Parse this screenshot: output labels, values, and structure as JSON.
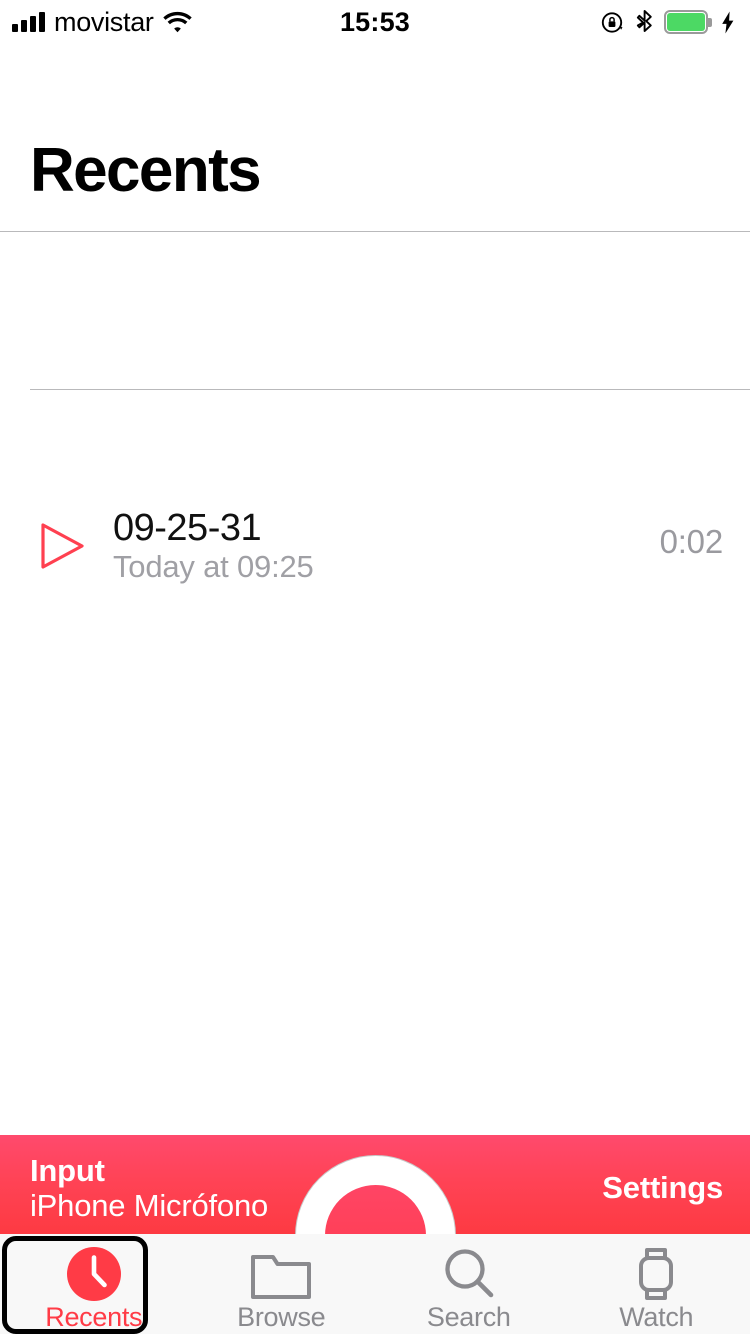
{
  "status_bar": {
    "carrier": "movistar",
    "time": "15:53",
    "signal_icon": "cellular-bars-icon",
    "wifi_icon": "wifi-icon",
    "rotation_lock_icon": "rotation-lock-icon",
    "bluetooth_icon": "bluetooth-icon",
    "battery_icon": "battery-icon",
    "charging_icon": "charging-bolt-icon",
    "battery_color": "#4CD964"
  },
  "header": {
    "title": "Recents"
  },
  "memos": [
    {
      "title": "09-25-31",
      "subtitle": "Today at 09:25",
      "duration": "0:02",
      "play_icon": "play-triangle-icon"
    }
  ],
  "input_bar": {
    "label": "Input",
    "value": "iPhone Micrófono",
    "settings_label": "Settings",
    "gradient_top": "#FF4A6D",
    "gradient_bottom": "#FD3A42"
  },
  "record_button": {
    "name": "record-button",
    "fill_color": "#FF3B4B"
  },
  "tab_bar": {
    "active_color": "#FF3B46",
    "inactive_color": "#8A8A8E",
    "items": [
      {
        "label": "Recents",
        "icon": "clock-icon",
        "active": true
      },
      {
        "label": "Browse",
        "icon": "folder-icon",
        "active": false
      },
      {
        "label": "Search",
        "icon": "search-icon",
        "active": false
      },
      {
        "label": "Watch",
        "icon": "watch-icon",
        "active": false
      }
    ]
  }
}
